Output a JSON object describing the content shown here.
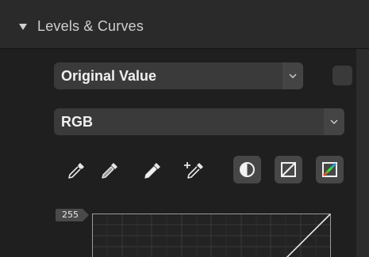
{
  "panel": {
    "title": "Levels & Curves",
    "collapse_icon": "triangle-down-icon"
  },
  "mode_select": {
    "value": "Original Value",
    "icon": "chevron-down-icon"
  },
  "channel_select": {
    "value": "RGB",
    "icon": "chevron-down-icon"
  },
  "tools": [
    {
      "name": "eyedropper-icon"
    },
    {
      "name": "eyedropper-gray-icon"
    },
    {
      "name": "eyedropper-white-icon"
    },
    {
      "name": "eyedropper-plus-icon"
    }
  ],
  "buttons": [
    {
      "name": "contrast-icon"
    },
    {
      "name": "curve-linear-icon"
    },
    {
      "name": "curve-color-icon"
    }
  ],
  "curve": {
    "max_label": "255"
  },
  "colors": {
    "panel_bg": "#1e1e1e",
    "control_bg": "#3a3a3a",
    "button_bg": "#474747",
    "text": "#f0f0f0"
  }
}
